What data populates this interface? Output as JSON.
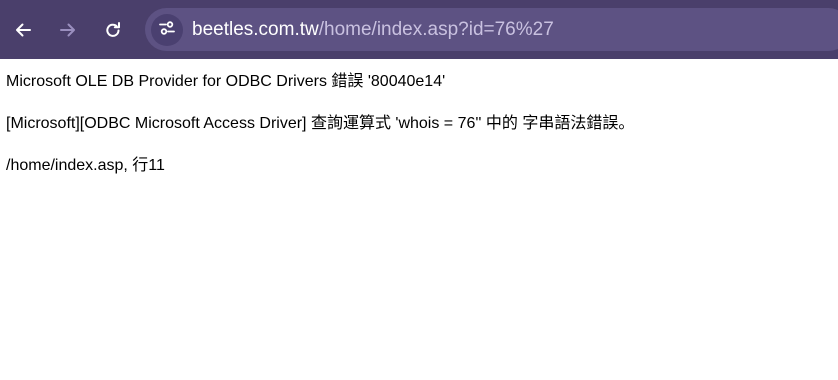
{
  "browser": {
    "url_host": "beetles.com.tw",
    "url_path": "/home/index.asp?id=76%27",
    "icons": {
      "back": "arrow-left-icon",
      "forward": "arrow-right-icon",
      "reload": "reload-icon",
      "site_info": "tune-icon"
    },
    "colors": {
      "toolbar": "#4a3f6b",
      "omnibox": "#5d5283"
    }
  },
  "page": {
    "error_header": "Microsoft OLE DB Provider for ODBC Drivers 錯誤 '80040e14'",
    "error_message": "[Microsoft][ODBC Microsoft Access Driver] 查詢運算式 'whois = 76'' 中的 字串語法錯誤。",
    "error_location": "/home/index.asp, 行11"
  }
}
